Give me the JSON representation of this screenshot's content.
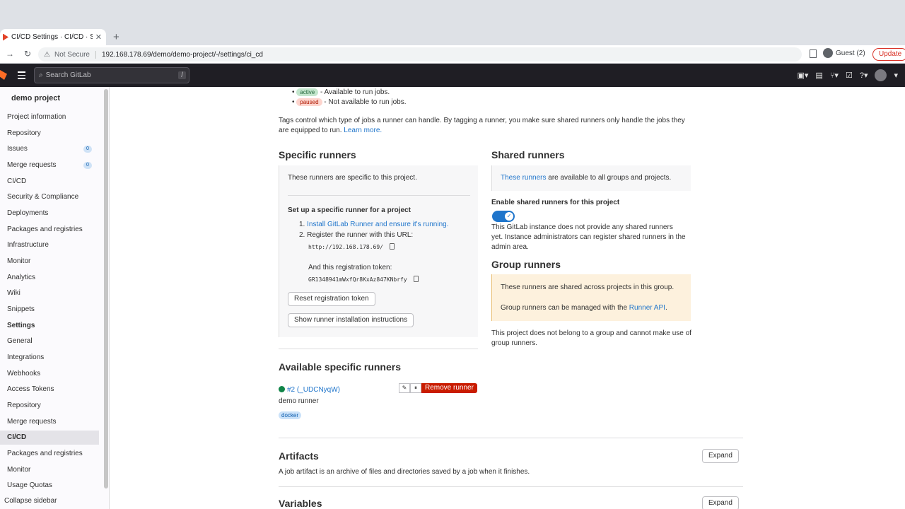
{
  "browser": {
    "tab_title": "CI/CD Settings · CI/CD · Setting",
    "address_warning": "Not Secure",
    "url": "192.168.178.69/demo/demo-project/-/settings/ci_cd",
    "profile": "Guest (2)",
    "update_label": "Update"
  },
  "topbar": {
    "search_placeholder": "Search GitLab",
    "search_shortcut": "/"
  },
  "sidebar": {
    "project_name": "demo project",
    "items": [
      {
        "label": "Project information"
      },
      {
        "label": "Repository"
      },
      {
        "label": "Issues",
        "badge": "0"
      },
      {
        "label": "Merge requests",
        "badge": "0"
      },
      {
        "label": "CI/CD"
      },
      {
        "label": "Security & Compliance"
      },
      {
        "label": "Deployments"
      },
      {
        "label": "Packages and registries"
      },
      {
        "label": "Infrastructure"
      },
      {
        "label": "Monitor"
      },
      {
        "label": "Analytics"
      },
      {
        "label": "Wiki"
      },
      {
        "label": "Snippets"
      },
      {
        "label": "Settings"
      },
      {
        "label": "General"
      },
      {
        "label": "Integrations"
      },
      {
        "label": "Webhooks"
      },
      {
        "label": "Access Tokens"
      },
      {
        "label": "Repository"
      },
      {
        "label": "Merge requests"
      },
      {
        "label": "CI/CD"
      },
      {
        "label": "Packages and registries"
      },
      {
        "label": "Monitor"
      },
      {
        "label": "Usage Quotas"
      }
    ],
    "collapse_label": "Collapse sidebar"
  },
  "status_list": {
    "active_badge": "active",
    "active_text": " - Available to run jobs.",
    "paused_badge": "paused",
    "paused_text": " - Not available to run jobs."
  },
  "tags_text": "Tags control which type of jobs a runner can handle. By tagging a runner, you make sure shared runners only handle the jobs they are equipped to run.",
  "tags_link": "Learn more.",
  "specific": {
    "title": "Specific runners",
    "intro": "These runners are specific to this project.",
    "setup_title": "Set up a specific runner for a project",
    "step1_num": "1.",
    "step1_link": "Install GitLab Runner and ensure it's running.",
    "step2_num": "2.",
    "step2_text": "Register the runner with this URL:",
    "url_code": "http://192.168.178.69/",
    "token_label": "And this registration token:",
    "token_code": "GR1348941mWxfQr8KxAz847KNbrfy",
    "reset_button": "Reset registration token",
    "show_button": "Show runner installation instructions"
  },
  "shared": {
    "title": "Shared runners",
    "intro_link": "These runners",
    "intro_text": " are available to all groups and projects.",
    "enable_label": "Enable shared runners for this project",
    "toggle_on": true,
    "toggle_check": "✓",
    "note": "This GitLab instance does not provide any shared runners yet. Instance administrators can register shared runners in the admin area."
  },
  "group": {
    "title": "Group runners",
    "warn1": "These runners are shared across projects in this group.",
    "warn2_text": "Group runners can be managed with the ",
    "warn2_link": "Runner API",
    "warn2_end": ".",
    "note": "This project does not belong to a group and cannot make use of group runners."
  },
  "available": {
    "title": "Available specific runners",
    "runner_id": "#2 (_UDCNyqW)",
    "runner_desc": "demo runner",
    "runner_tag": "docker",
    "edit_icon": "✎",
    "pause_icon": "⏸",
    "remove_button": "Remove runner"
  },
  "artifacts": {
    "title": "Artifacts",
    "desc": "A job artifact is an archive of files and directories saved by a job when it finishes.",
    "expand": "Expand"
  },
  "variables": {
    "title": "Variables",
    "expand": "Expand"
  },
  "colors": {
    "gitlab_orange": "#fc6d26",
    "link_blue": "#1f75cb",
    "danger_red": "#c91c00",
    "topbar_bg": "#1f1e24"
  }
}
